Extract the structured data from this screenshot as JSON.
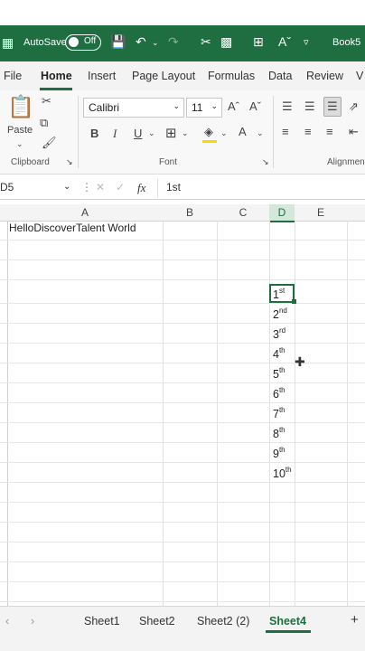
{
  "titlebar": {
    "autosave_label": "AutoSave",
    "toggle_label": "Off",
    "book_name": "Book5",
    "colors": {
      "bar": "#1e6e42"
    }
  },
  "menu": {
    "tabs": [
      "File",
      "Home",
      "Insert",
      "Page Layout",
      "Formulas",
      "Data",
      "Review",
      "V"
    ],
    "active": "Home"
  },
  "ribbon": {
    "paste_label": "Paste",
    "font_name": "Calibri",
    "font_size": "11",
    "groups": {
      "clipboard": "Clipboard",
      "font": "Font",
      "alignment": "Alignmen"
    },
    "bold": "B",
    "italic": "I",
    "underline": "U"
  },
  "formula_bar": {
    "name_box": "D5",
    "formula": "1st",
    "fx": "fx"
  },
  "grid": {
    "columns": [
      "A",
      "B",
      "C",
      "D",
      "E"
    ],
    "selected_column": "D",
    "a1_text": "HelloDiscoverTalent World",
    "ordinals": [
      {
        "num": "1",
        "suf": "st"
      },
      {
        "num": "2",
        "suf": "nd"
      },
      {
        "num": "3",
        "suf": "rd"
      },
      {
        "num": "4",
        "suf": "th"
      },
      {
        "num": "5",
        "suf": "th"
      },
      {
        "num": "6",
        "suf": "th"
      },
      {
        "num": "7",
        "suf": "th"
      },
      {
        "num": "8",
        "suf": "th"
      },
      {
        "num": "9",
        "suf": "th"
      },
      {
        "num": "10",
        "suf": "th"
      }
    ]
  },
  "sheets": {
    "tabs": [
      "Sheet1",
      "Sheet2",
      "Sheet2 (2)",
      "Sheet4"
    ],
    "active": "Sheet4"
  }
}
